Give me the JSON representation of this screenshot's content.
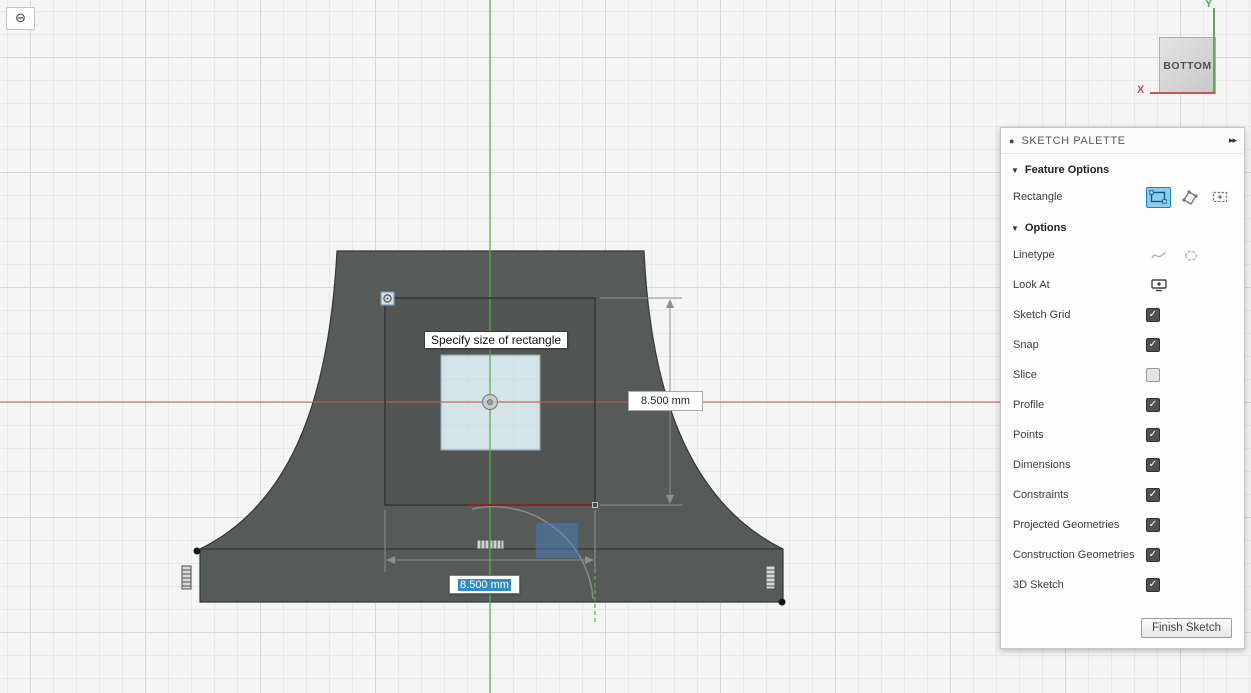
{
  "viewport": {
    "tooltip": "Specify size of rectangle",
    "dimension_vertical": {
      "value": "8.500 mm"
    },
    "dimension_horizontal": {
      "value": "8.500 mm"
    },
    "viewcube": {
      "face_label": "BOTTOM"
    },
    "axis": {
      "x_label": "X",
      "y_label": "Y"
    }
  },
  "icons": {
    "browser_toggle": "⊖",
    "palette_grip": "●",
    "palette_collapse": "▸▸",
    "check": "✓",
    "section_triangle": "▼"
  },
  "palette": {
    "title": "SKETCH PALETTE",
    "sections": [
      {
        "title": "Feature Options",
        "rows": [
          {
            "label": "Rectangle",
            "control": "rectangle-type-icons",
            "icons": [
              "two-point-rectangle",
              "three-point-rectangle",
              "center-rectangle"
            ],
            "selected": 0
          }
        ]
      },
      {
        "title": "Options",
        "rows": [
          {
            "label": "Linetype",
            "control": "linetype-icons"
          },
          {
            "label": "Look At",
            "control": "lookat-icon"
          },
          {
            "label": "Sketch Grid",
            "control": "checkbox",
            "checked": true
          },
          {
            "label": "Snap",
            "control": "checkbox",
            "checked": true
          },
          {
            "label": "Slice",
            "control": "checkbox",
            "checked": false
          },
          {
            "label": "Profile",
            "control": "checkbox",
            "checked": true
          },
          {
            "label": "Points",
            "control": "checkbox",
            "checked": true
          },
          {
            "label": "Dimensions",
            "control": "checkbox",
            "checked": true
          },
          {
            "label": "Constraints",
            "control": "checkbox",
            "checked": true
          },
          {
            "label": "Projected Geometries",
            "control": "checkbox",
            "checked": true
          },
          {
            "label": "Construction Geometries",
            "control": "checkbox",
            "checked": true
          },
          {
            "label": "3D Sketch",
            "control": "checkbox",
            "checked": true
          }
        ]
      }
    ],
    "finish_button": "Finish Sketch"
  },
  "colors": {
    "accent_blue": "#1785c4",
    "selection_blue": "#308cc6",
    "model_fill": "#565b59",
    "axis_x_red": "#c65853",
    "axis_y_green": "#57b14b"
  }
}
